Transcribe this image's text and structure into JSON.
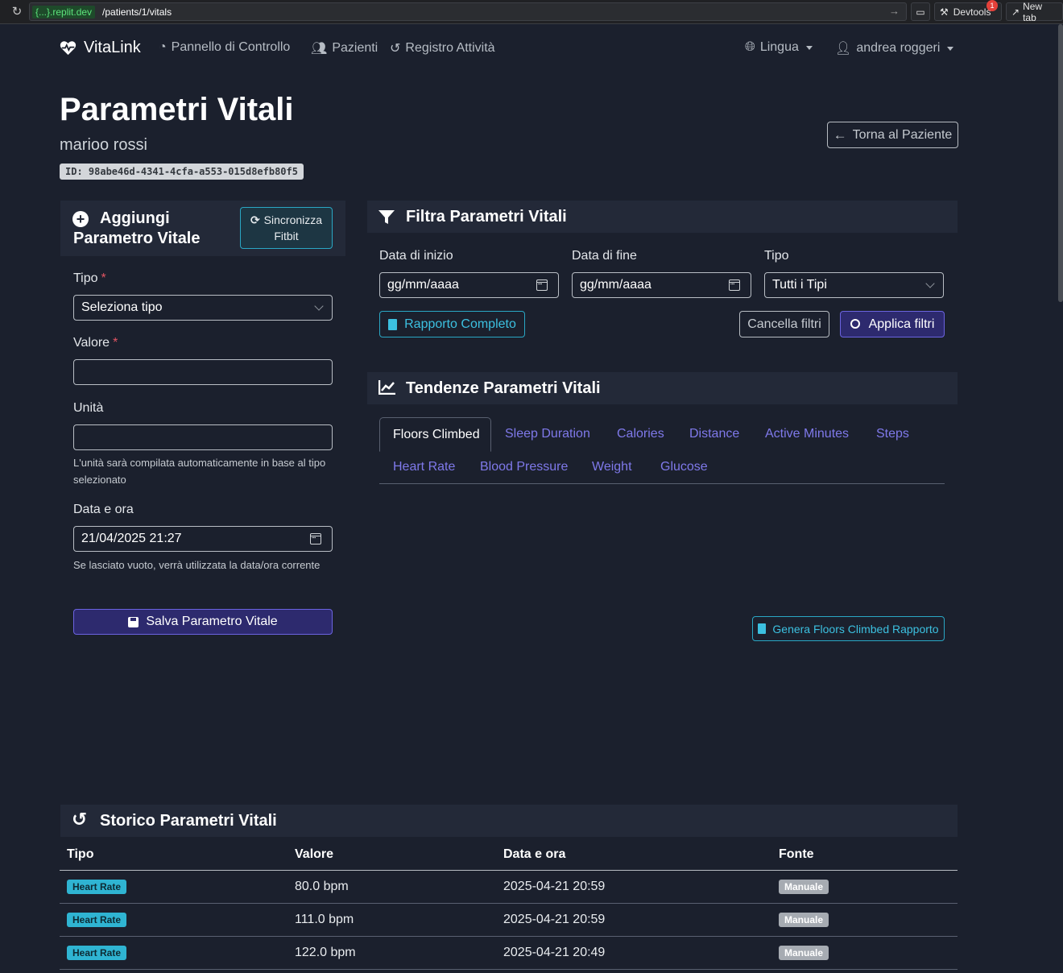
{
  "browser": {
    "url_host": "{...}.replit.dev",
    "url_path": "/patients/1/vitals",
    "devtools_label": "Devtools",
    "devtools_badge": "1",
    "new_tab_label": "New tab"
  },
  "nav": {
    "brand": "VitaLink",
    "links": [
      "Pannello di Controllo",
      "Pazienti",
      "Registro Attività"
    ],
    "language": "Lingua",
    "user": "andrea roggeri"
  },
  "header": {
    "title": "Parametri Vitali",
    "patient_name": "marioo rossi",
    "patient_id": "ID: 98abe46d-4341-4cfa-a553-015d8efb80f5",
    "back_button": "Torna al Paziente"
  },
  "add_vital": {
    "title_line1": "Aggiungi",
    "title_line2": "Parametro Vitale",
    "sync_line1": "Sincronizza",
    "sync_line2": "Fitbit",
    "type_label": "Tipo",
    "type_value": "Seleziona tipo",
    "value_label": "Valore",
    "required_mark": "*",
    "unit_label": "Unità",
    "unit_help": "L'unità sarà compilata automaticamente in base al tipo selezionato",
    "datetime_label": "Data e ora",
    "datetime_value": "21/04/2025 21:27",
    "datetime_help": "Se lasciato vuoto, verrà utilizzata la data/ora corrente",
    "save_button": "Salva Parametro Vitale"
  },
  "filter": {
    "title": "Filtra Parametri Vitali",
    "start_label": "Data di inizio",
    "start_placeholder": "gg/mm/aaaa",
    "end_label": "Data di fine",
    "end_placeholder": "gg/mm/aaaa",
    "type_label": "Tipo",
    "type_value": "Tutti i Tipi",
    "report_button": "Rapporto Completo",
    "clear_button": "Cancella filtri",
    "apply_button": "Applica filtri"
  },
  "trends": {
    "title": "Tendenze Parametri Vitali",
    "tabs": [
      "Floors Climbed",
      "Sleep Duration",
      "Calories",
      "Distance",
      "Active Minutes",
      "Steps",
      "Heart Rate",
      "Blood Pressure",
      "Weight",
      "Glucose"
    ],
    "active_tab": "Floors Climbed",
    "report_button": "Genera Floors Climbed Rapporto"
  },
  "history": {
    "title": "Storico Parametri Vitali",
    "columns": [
      "Tipo",
      "Valore",
      "Data e ora",
      "Fonte"
    ],
    "rows": [
      {
        "type": "Heart Rate",
        "value": "80.0 bpm",
        "datetime": "2025-04-21 20:59",
        "source": "Manuale"
      },
      {
        "type": "Heart Rate",
        "value": "111.0 bpm",
        "datetime": "2025-04-21 20:59",
        "source": "Manuale"
      },
      {
        "type": "Heart Rate",
        "value": "122.0 bpm",
        "datetime": "2025-04-21 20:49",
        "source": "Manuale"
      }
    ]
  },
  "colors": {
    "background": "#1b202d",
    "card_header": "#232938",
    "primary": "#6b63e0",
    "info": "#2aa7c4"
  }
}
